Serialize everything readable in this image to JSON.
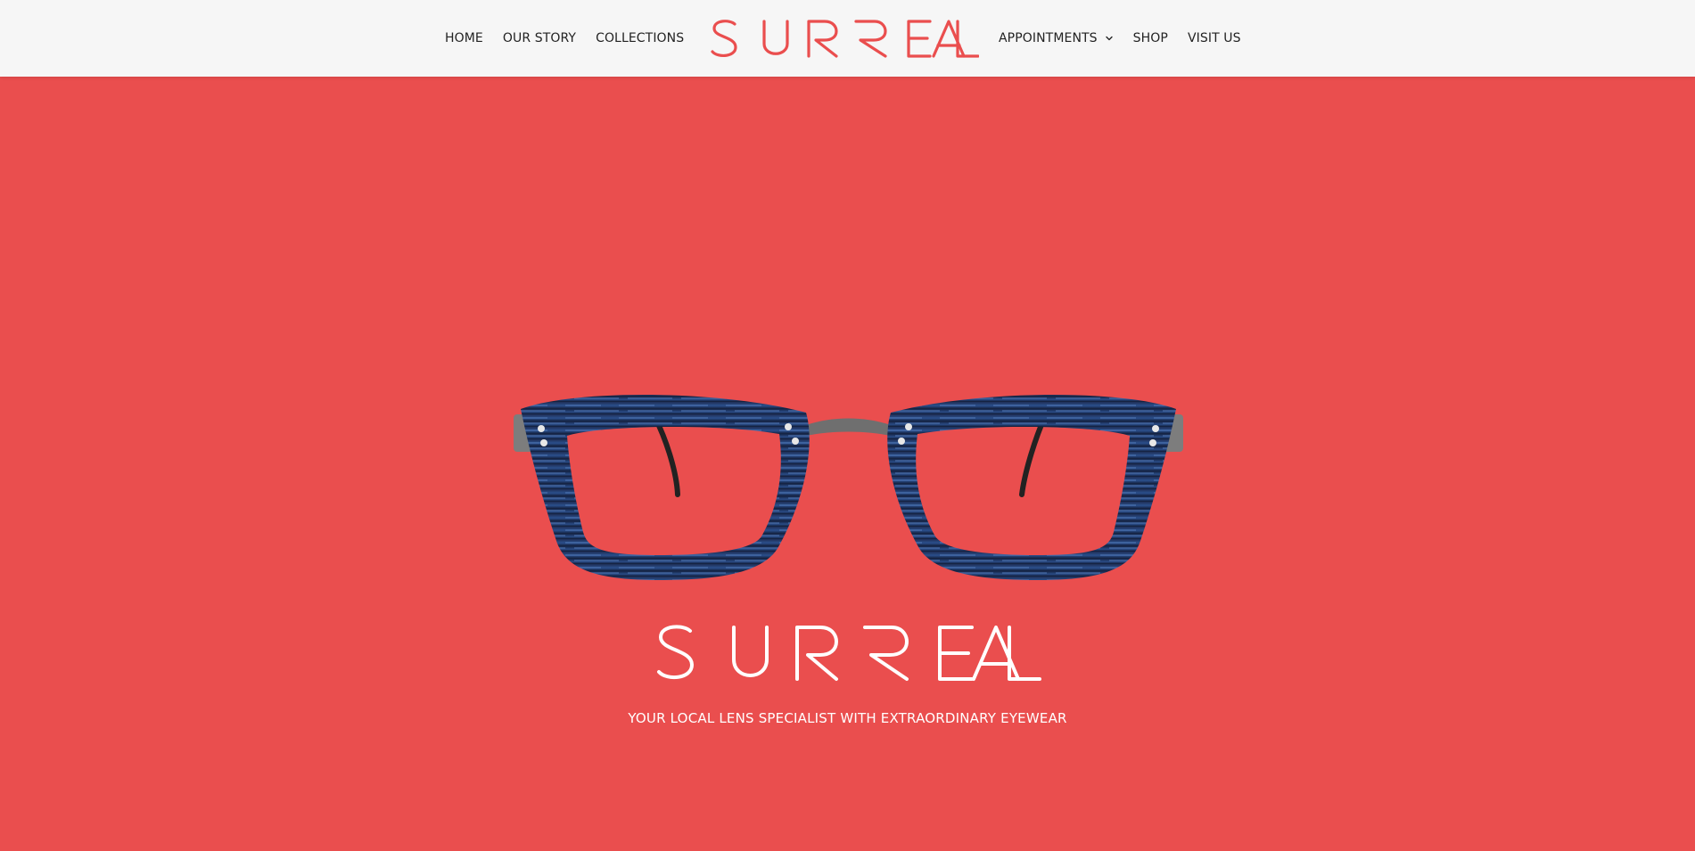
{
  "brand": {
    "name": "SURREAL",
    "accent_color": "#ea4e4e",
    "text_color": "#222222"
  },
  "nav": {
    "left": [
      {
        "label": "HOME"
      },
      {
        "label": "OUR STORY"
      },
      {
        "label": "COLLECTIONS"
      }
    ],
    "right": [
      {
        "label": "APPOINTMENTS",
        "icon": "chevron-down-icon"
      },
      {
        "label": "SHOP"
      },
      {
        "label": "VISIT US"
      }
    ]
  },
  "hero": {
    "background_color": "#ea4e4e",
    "image": "eyeglasses-image",
    "tagline": "YOUR LOCAL LENS SPECIALIST WITH EXTRAORDINARY EYEWEAR"
  }
}
